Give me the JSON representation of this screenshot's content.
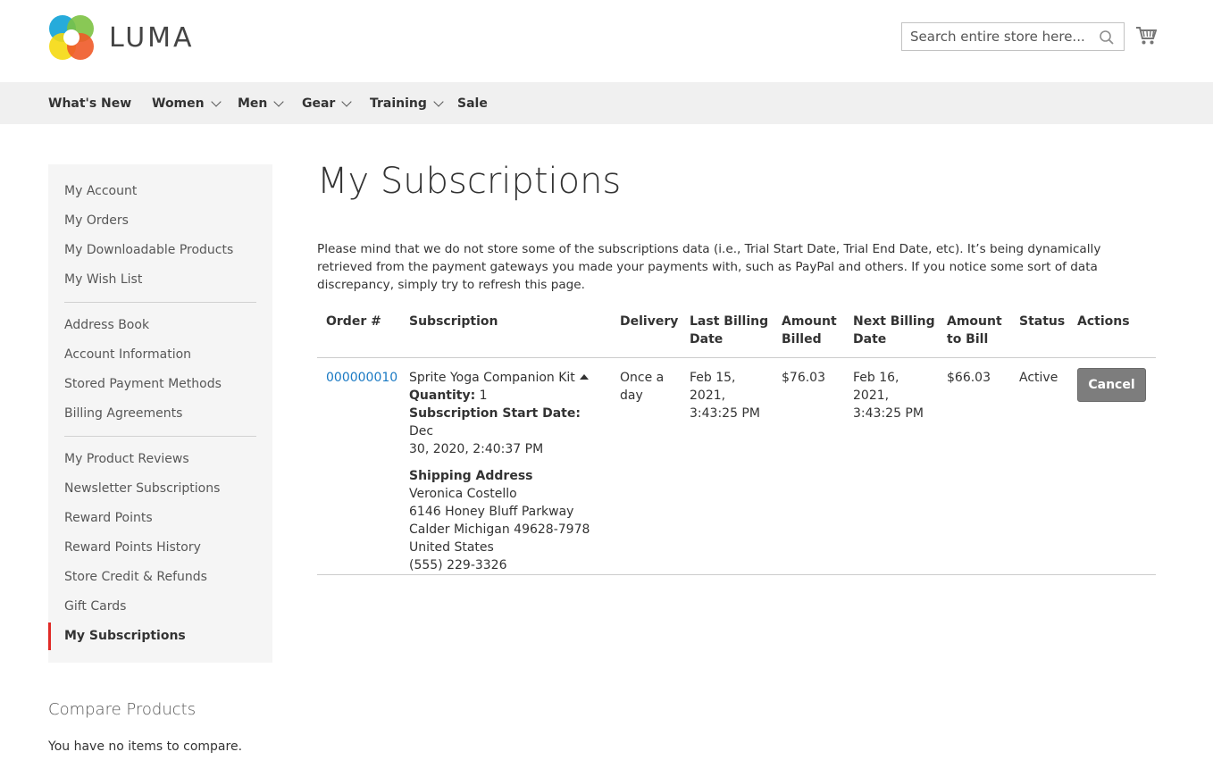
{
  "brand": {
    "name": "LUMA"
  },
  "search": {
    "placeholder": "Search entire store here..."
  },
  "nav": [
    {
      "label": "What's New",
      "has_dropdown": false
    },
    {
      "label": "Women",
      "has_dropdown": true
    },
    {
      "label": "Men",
      "has_dropdown": true
    },
    {
      "label": "Gear",
      "has_dropdown": true
    },
    {
      "label": "Training",
      "has_dropdown": true
    },
    {
      "label": "Sale",
      "has_dropdown": false
    }
  ],
  "sidebar": {
    "groups": [
      [
        "My Account",
        "My Orders",
        "My Downloadable Products",
        "My Wish List"
      ],
      [
        "Address Book",
        "Account Information",
        "Stored Payment Methods",
        "Billing Agreements"
      ],
      [
        "My Product Reviews",
        "Newsletter Subscriptions",
        "Reward Points",
        "Reward Points History",
        "Store Credit & Refunds",
        "Gift Cards",
        "My Subscriptions"
      ]
    ],
    "active": "My Subscriptions"
  },
  "compare": {
    "title": "Compare Products",
    "empty": "You have no items to compare."
  },
  "main": {
    "title": "My Subscriptions",
    "notice": "Please mind that we do not store some of the subscriptions data (i.e., Trial Start Date, Trial End Date, etc). It’s being dynamically retrieved from the payment gateways you made your payments with, such as PayPal and others. If you notice some sort of data discrepancy, simply try to refresh this page."
  },
  "table": {
    "headers": {
      "order": "Order #",
      "subscription": "Subscription",
      "delivery": "Delivery",
      "last_billing_1": "Last Billing",
      "last_billing_2": "Date",
      "amount_billed_1": "Amount",
      "amount_billed_2": "Billed",
      "next_billing_1": "Next Billing",
      "next_billing_2": "Date",
      "amount_to_bill_1": "Amount",
      "amount_to_bill_2": "to Bill",
      "status": "Status",
      "actions": "Actions"
    },
    "row": {
      "order": "000000010",
      "product": "Sprite Yoga Companion Kit",
      "quantity_label": "Quantity:",
      "quantity": "1",
      "start_label": "Subscription Start Date:",
      "start_value_1": "Dec",
      "start_value_2": "30, 2020, 2:40:37 PM",
      "shipping_label": "Shipping Address",
      "shipping_name": "Veronica Costello",
      "shipping_street": "6146 Honey Bluff Parkway",
      "shipping_city": "Calder Michigan 49628-7978",
      "shipping_country": "United States",
      "shipping_phone": "(555) 229-3326",
      "delivery_1": "Once a",
      "delivery_2": "day",
      "last_billing_1": "Feb 15,",
      "last_billing_2": "2021,",
      "last_billing_3": "3:43:25 PM",
      "amount_billed": "$76.03",
      "next_billing_1": "Feb 16,",
      "next_billing_2": "2021,",
      "next_billing_3": "3:43:25 PM",
      "amount_to_bill": "$66.03",
      "status": "Active",
      "action_label": "Cancel"
    }
  },
  "colors": {
    "link": "#1979c3",
    "active_marker": "#e02b27",
    "nav_bg": "#f0f0f0",
    "sidebar_bg": "#f5f5f5",
    "button_bg": "#7d7d7d"
  }
}
